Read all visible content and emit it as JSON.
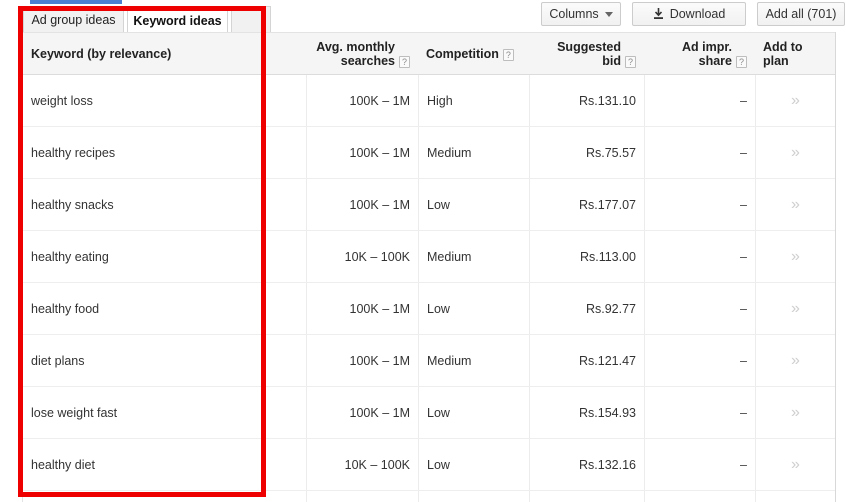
{
  "tabs": [
    {
      "label": "Ad group ideas",
      "active": false
    },
    {
      "label": "Keyword ideas",
      "active": true
    }
  ],
  "toolbar": {
    "columns_label": "Columns",
    "download_label": "Download",
    "add_all_label": "Add all (701)",
    "columns_icon": "chevron-down-icon",
    "download_icon": "download-icon"
  },
  "table": {
    "columns": [
      {
        "key": "keyword",
        "label": "Keyword (by relevance)",
        "help": false
      },
      {
        "key": "volume",
        "label_line1": "Avg. monthly",
        "label_line2": "searches",
        "help": true
      },
      {
        "key": "competition",
        "label": "Competition",
        "help": true
      },
      {
        "key": "bid",
        "label": "Suggested bid",
        "help": true
      },
      {
        "key": "impr",
        "label": "Ad impr. share",
        "help": true
      },
      {
        "key": "plan",
        "label": "Add to plan",
        "help": false
      }
    ],
    "help_glyph": "?",
    "add_glyph": "»",
    "rows": [
      {
        "keyword": "weight loss",
        "volume": "100K – 1M",
        "competition": "High",
        "bid": "Rs.131.10",
        "impr": "–",
        "plan": "»"
      },
      {
        "keyword": "healthy recipes",
        "volume": "100K – 1M",
        "competition": "Medium",
        "bid": "Rs.75.57",
        "impr": "–",
        "plan": "»"
      },
      {
        "keyword": "healthy snacks",
        "volume": "100K – 1M",
        "competition": "Low",
        "bid": "Rs.177.07",
        "impr": "–",
        "plan": "»"
      },
      {
        "keyword": "healthy eating",
        "volume": "10K – 100K",
        "competition": "Medium",
        "bid": "Rs.113.00",
        "impr": "–",
        "plan": "»"
      },
      {
        "keyword": "healthy food",
        "volume": "100K – 1M",
        "competition": "Low",
        "bid": "Rs.92.77",
        "impr": "–",
        "plan": "»"
      },
      {
        "keyword": "diet plans",
        "volume": "100K – 1M",
        "competition": "Medium",
        "bid": "Rs.121.47",
        "impr": "–",
        "plan": "»"
      },
      {
        "keyword": "lose weight fast",
        "volume": "100K – 1M",
        "competition": "Low",
        "bid": "Rs.154.93",
        "impr": "–",
        "plan": "»"
      },
      {
        "keyword": "healthy diet",
        "volume": "10K – 100K",
        "competition": "Low",
        "bid": "Rs.132.16",
        "impr": "–",
        "plan": "»"
      }
    ]
  },
  "annotation": {
    "shape": "rectangle",
    "color": "#ee0000"
  },
  "colors": {
    "accent_blue": "#4d7fd1",
    "annotation_red": "#ee0000",
    "header_bg": "#f5f5f5",
    "row_border": "#eeeeee"
  }
}
